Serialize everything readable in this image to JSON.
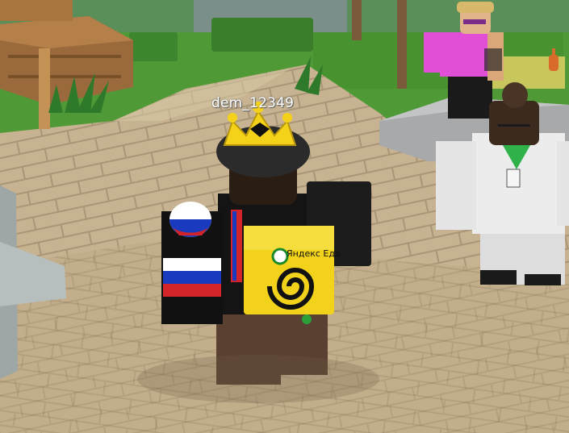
{
  "player": {
    "username": "dem_12349",
    "backpack_text": "Яндекс Еда",
    "accessories": [
      "crown-icon",
      "russia-flag-ball-icon",
      "food-delivery-backpack"
    ]
  },
  "npcs": [
    {
      "outfit": "pink-shirt-sunglasses"
    },
    {
      "outfit": "white-suit-topknot"
    }
  ],
  "colors": {
    "sky_grass": "#3f8a2c",
    "paving": "#c9b594",
    "crown": "#f5d21a",
    "backpack": "#f3d21c"
  }
}
